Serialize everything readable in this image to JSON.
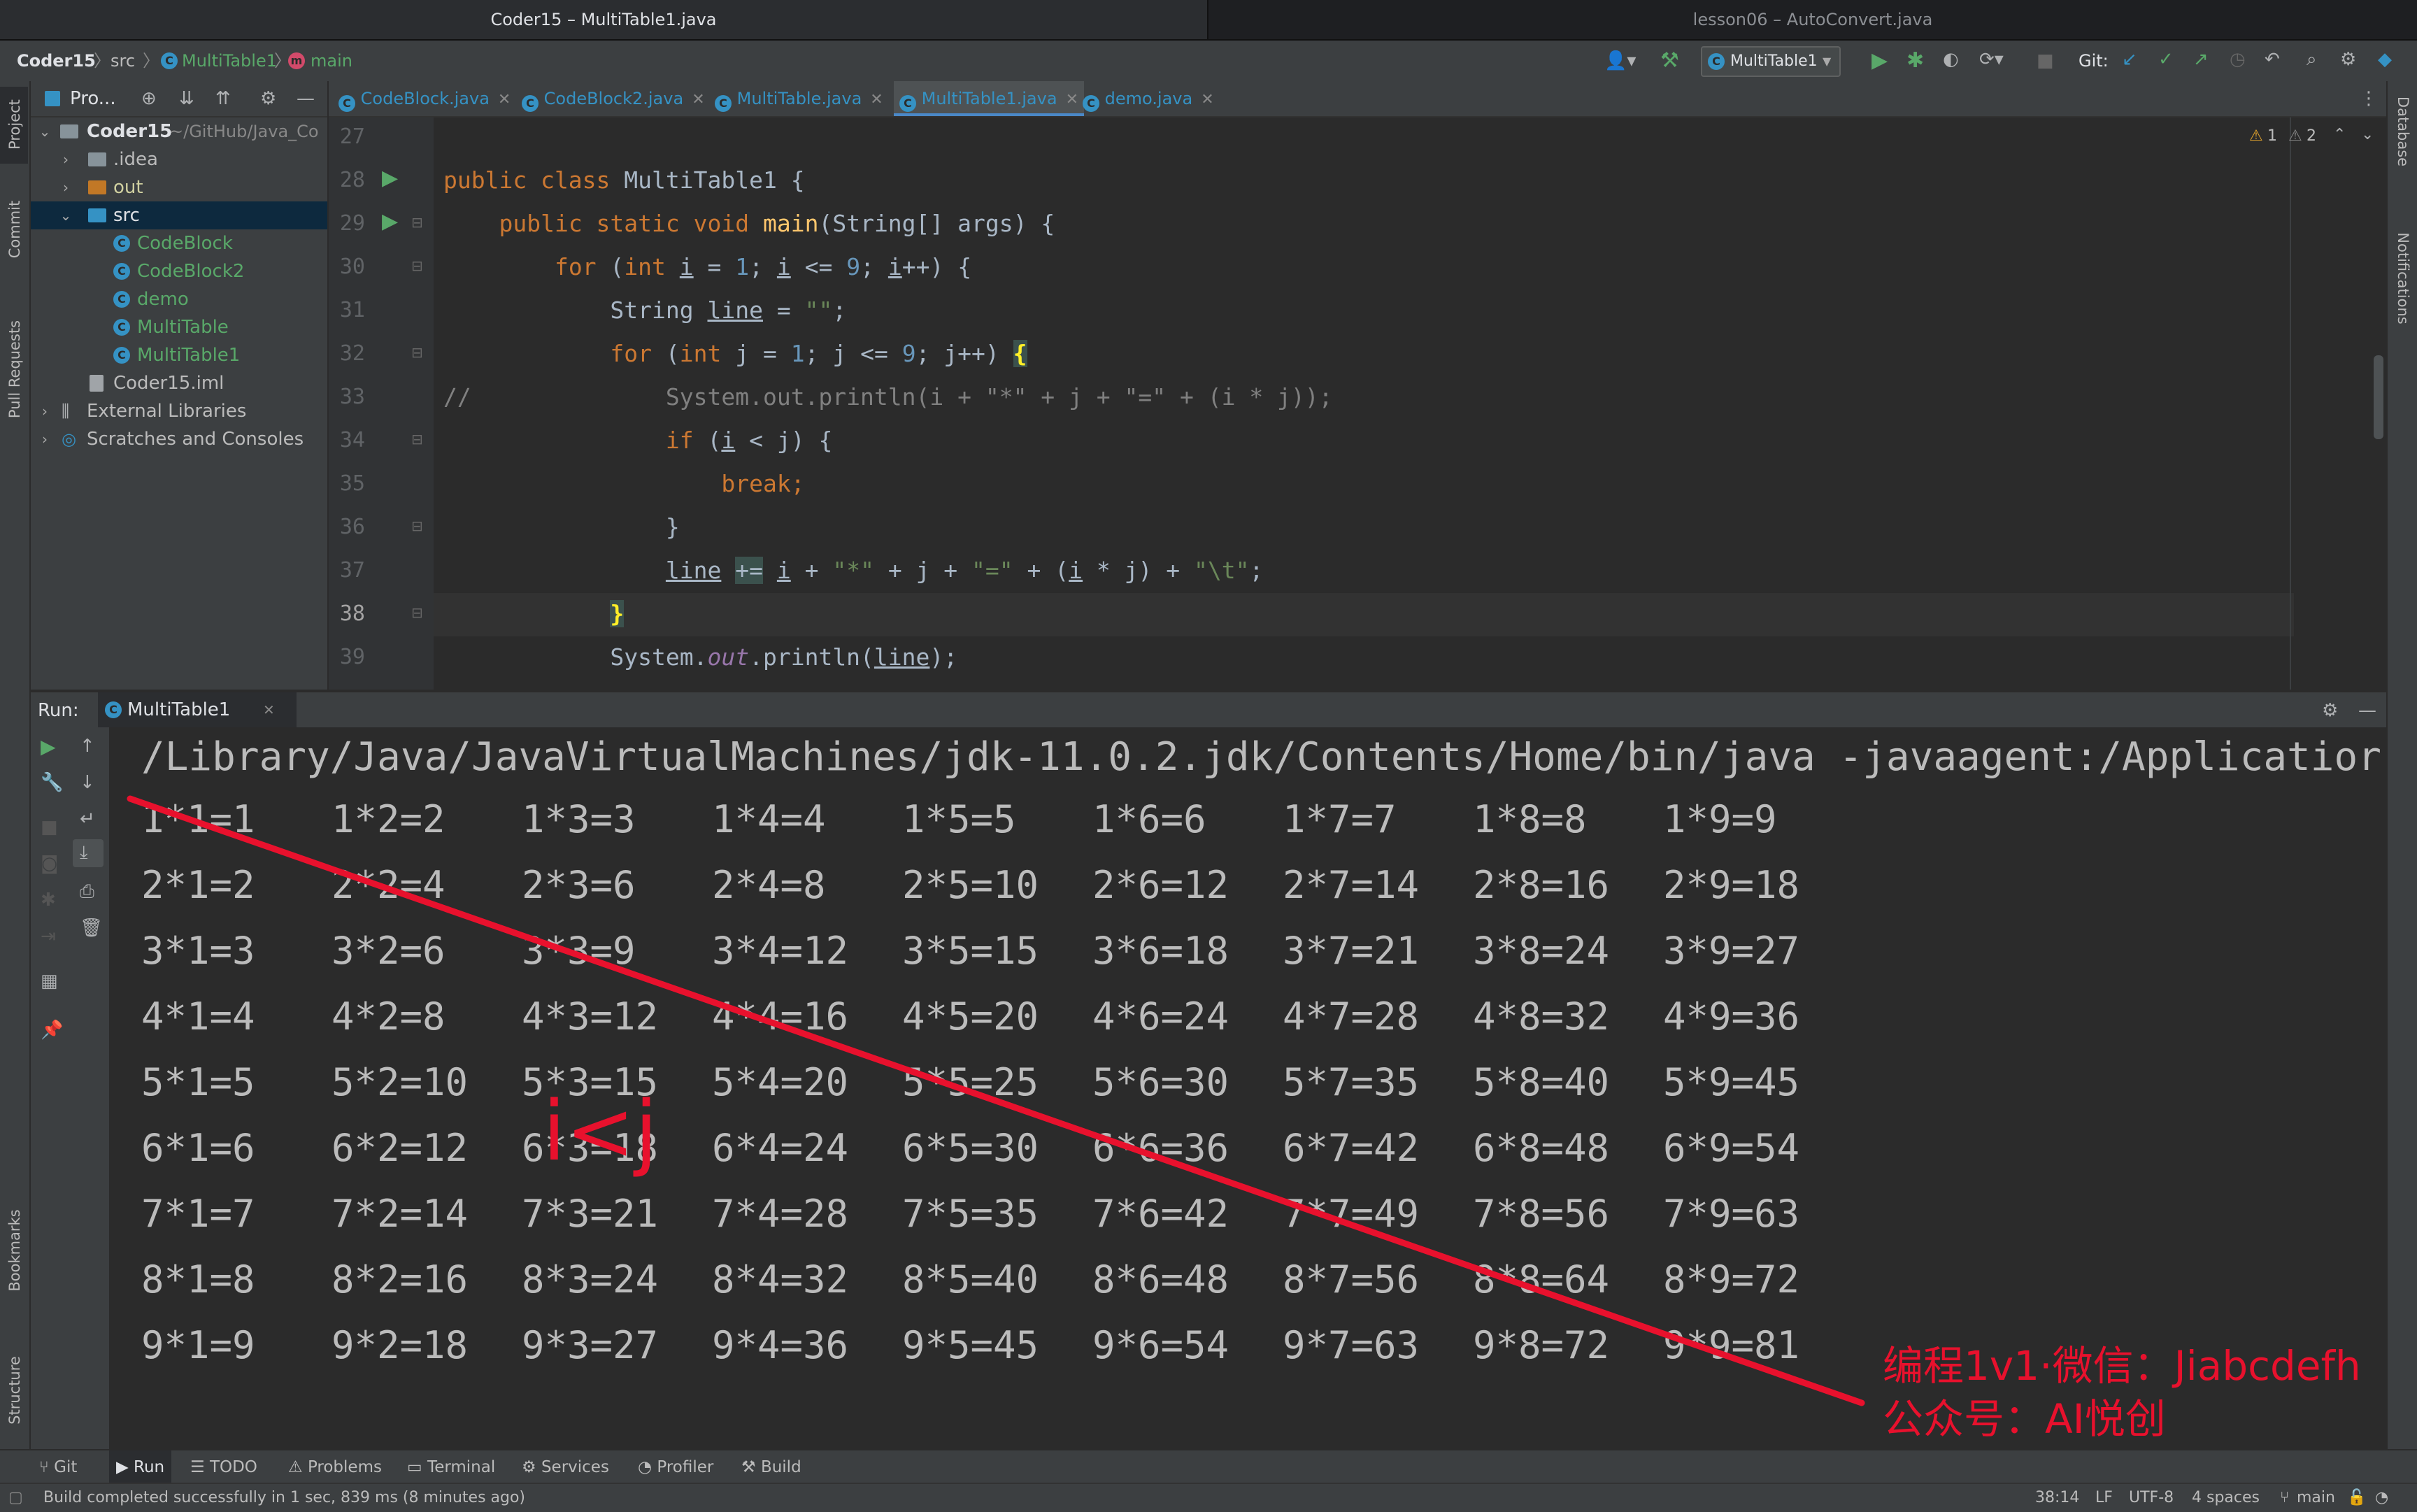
{
  "window_tabs": [
    "Coder15 – MultiTable1.java",
    "lesson06 – AutoConvert.java"
  ],
  "breadcrumb": {
    "project": "Coder15",
    "folder": "src",
    "class": "MultiTable1",
    "method": "main"
  },
  "run_config": "MultiTable1",
  "git_label": "Git:",
  "left_stripe": [
    "Project",
    "Commit",
    "Pull Requests",
    "Bookmarks",
    "Structure"
  ],
  "right_stripe": [
    "Database",
    "Notifications"
  ],
  "project_pane": {
    "title": "Pro...",
    "tree": [
      {
        "label": "Coder15",
        "extra": "~/GitHub/Java_Co"
      },
      {
        "label": ".idea"
      },
      {
        "label": "out"
      },
      {
        "label": "src"
      },
      {
        "label": "CodeBlock"
      },
      {
        "label": "CodeBlock2"
      },
      {
        "label": "demo"
      },
      {
        "label": "MultiTable"
      },
      {
        "label": "MultiTable1"
      },
      {
        "label": "Coder15.iml"
      },
      {
        "label": "External Libraries"
      },
      {
        "label": "Scratches and Consoles"
      }
    ]
  },
  "editor_tabs": [
    "CodeBlock.java",
    "CodeBlock2.java",
    "MultiTable.java",
    "MultiTable1.java",
    "demo.java"
  ],
  "inspections": {
    "warnings": "1",
    "weak_warnings": "2"
  },
  "editor_lines": [
    "27",
    "28",
    "29",
    "30",
    "31",
    "32",
    "33",
    "34",
    "35",
    "36",
    "37",
    "38",
    "39"
  ],
  "run_panel": {
    "label": "Run:",
    "tab": "MultiTable1",
    "command": "/Library/Java/JavaVirtualMachines/jdk-11.0.2.jdk/Contents/Home/bin/java -javaagent:/Applicatior",
    "output_rows": [
      [
        "1*1=1",
        "1*2=2",
        "1*3=3",
        "1*4=4",
        "1*5=5",
        "1*6=6",
        "1*7=7",
        "1*8=8",
        "1*9=9"
      ],
      [
        "2*1=2",
        "2*2=4",
        "2*3=6",
        "2*4=8",
        "2*5=10",
        "2*6=12",
        "2*7=14",
        "2*8=16",
        "2*9=18"
      ],
      [
        "3*1=3",
        "3*2=6",
        "3*3=9",
        "3*4=12",
        "3*5=15",
        "3*6=18",
        "3*7=21",
        "3*8=24",
        "3*9=27"
      ],
      [
        "4*1=4",
        "4*2=8",
        "4*3=12",
        "4*4=16",
        "4*5=20",
        "4*6=24",
        "4*7=28",
        "4*8=32",
        "4*9=36"
      ],
      [
        "5*1=5",
        "5*2=10",
        "5*3=15",
        "5*4=20",
        "5*5=25",
        "5*6=30",
        "5*7=35",
        "5*8=40",
        "5*9=45"
      ],
      [
        "6*1=6",
        "6*2=12",
        "6*3=18",
        "6*4=24",
        "6*5=30",
        "6*6=36",
        "6*7=42",
        "6*8=48",
        "6*9=54"
      ],
      [
        "7*1=7",
        "7*2=14",
        "7*3=21",
        "7*4=28",
        "7*5=35",
        "7*6=42",
        "7*7=49",
        "7*8=56",
        "7*9=63"
      ],
      [
        "8*1=8",
        "8*2=16",
        "8*3=24",
        "8*4=32",
        "8*5=40",
        "8*6=48",
        "8*7=56",
        "8*8=64",
        "8*9=72"
      ],
      [
        "9*1=9",
        "9*2=18",
        "9*3=27",
        "9*4=36",
        "9*5=45",
        "9*6=54",
        "9*7=63",
        "9*8=72",
        "9*9=81"
      ]
    ]
  },
  "annotations": {
    "handwritten": "i<j",
    "line1": "编程1v1·微信：Jiabcdefh",
    "line2": "公众号：AI悦创"
  },
  "tool_windows": [
    "Git",
    "Run",
    "TODO",
    "Problems",
    "Terminal",
    "Services",
    "Profiler",
    "Build"
  ],
  "status": {
    "message": "Build completed successfully in 1 sec, 839 ms (8 minutes ago)",
    "position": "38:14",
    "line_sep": "LF",
    "encoding": "UTF-8",
    "indent": "4 spaces",
    "branch": "main"
  },
  "colors": {
    "accent": "#4a88c7",
    "run_green": "#59a869",
    "annotation_red": "#e8112d",
    "class_blue": "#3592c4"
  }
}
